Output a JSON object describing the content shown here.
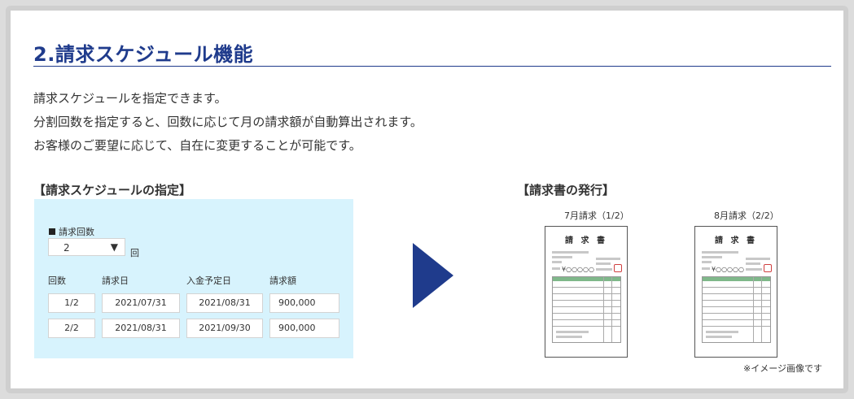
{
  "section": {
    "title": "2.請求スケジュール機能",
    "description": [
      "請求スケジュールを指定できます。",
      "分割回数を指定すると、回数に応じて月の請求額が自動算出されます。",
      "お客様のご要望に応じて、自在に変更することが可能です。"
    ]
  },
  "schedule": {
    "heading": "【請求スケジュールの指定】",
    "count_label": "請求回数",
    "count_value": "2",
    "count_unit": "回",
    "columns": [
      "回数",
      "請求日",
      "入金予定日",
      "請求額"
    ],
    "rows": [
      [
        "1/2",
        "2021/07/31",
        "2021/08/31",
        "900,000"
      ],
      [
        "2/2",
        "2021/08/31",
        "2021/09/30",
        "900,000"
      ]
    ]
  },
  "invoices": {
    "heading": "【請求書の発行】",
    "documents": [
      {
        "caption": "7月請求（1/2）",
        "doc_title": "請 求 書",
        "amount": "¥○○○○○"
      },
      {
        "caption": "8月請求（2/2）",
        "doc_title": "請 求 書",
        "amount": "¥○○○○○"
      }
    ],
    "note": "※イメージ画像です"
  },
  "colors": {
    "accent": "#1f3b8c",
    "panel_bg": "#d7f3fd",
    "table_header": "#7fb88a"
  },
  "icons": {
    "arrow": "next-arrow-icon",
    "dropdown": "triangle-down-icon"
  }
}
